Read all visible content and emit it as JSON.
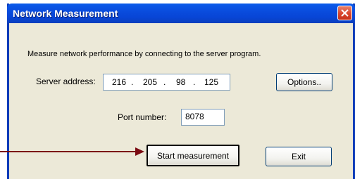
{
  "window": {
    "title": "Network Measurement"
  },
  "description": "Measure network performance by connecting to the server program.",
  "server": {
    "label": "Server address:",
    "octets": [
      "216",
      "205",
      "98",
      "125"
    ]
  },
  "options_label": "Options..",
  "port": {
    "label": "Port number:",
    "value": "8078"
  },
  "start_label": "Start measurement",
  "exit_label": "Exit",
  "colors": {
    "titlebar": "#0a4fe0",
    "window_bg": "#ece9d8",
    "close": "#d8452c",
    "arrow": "#7b0a12"
  }
}
